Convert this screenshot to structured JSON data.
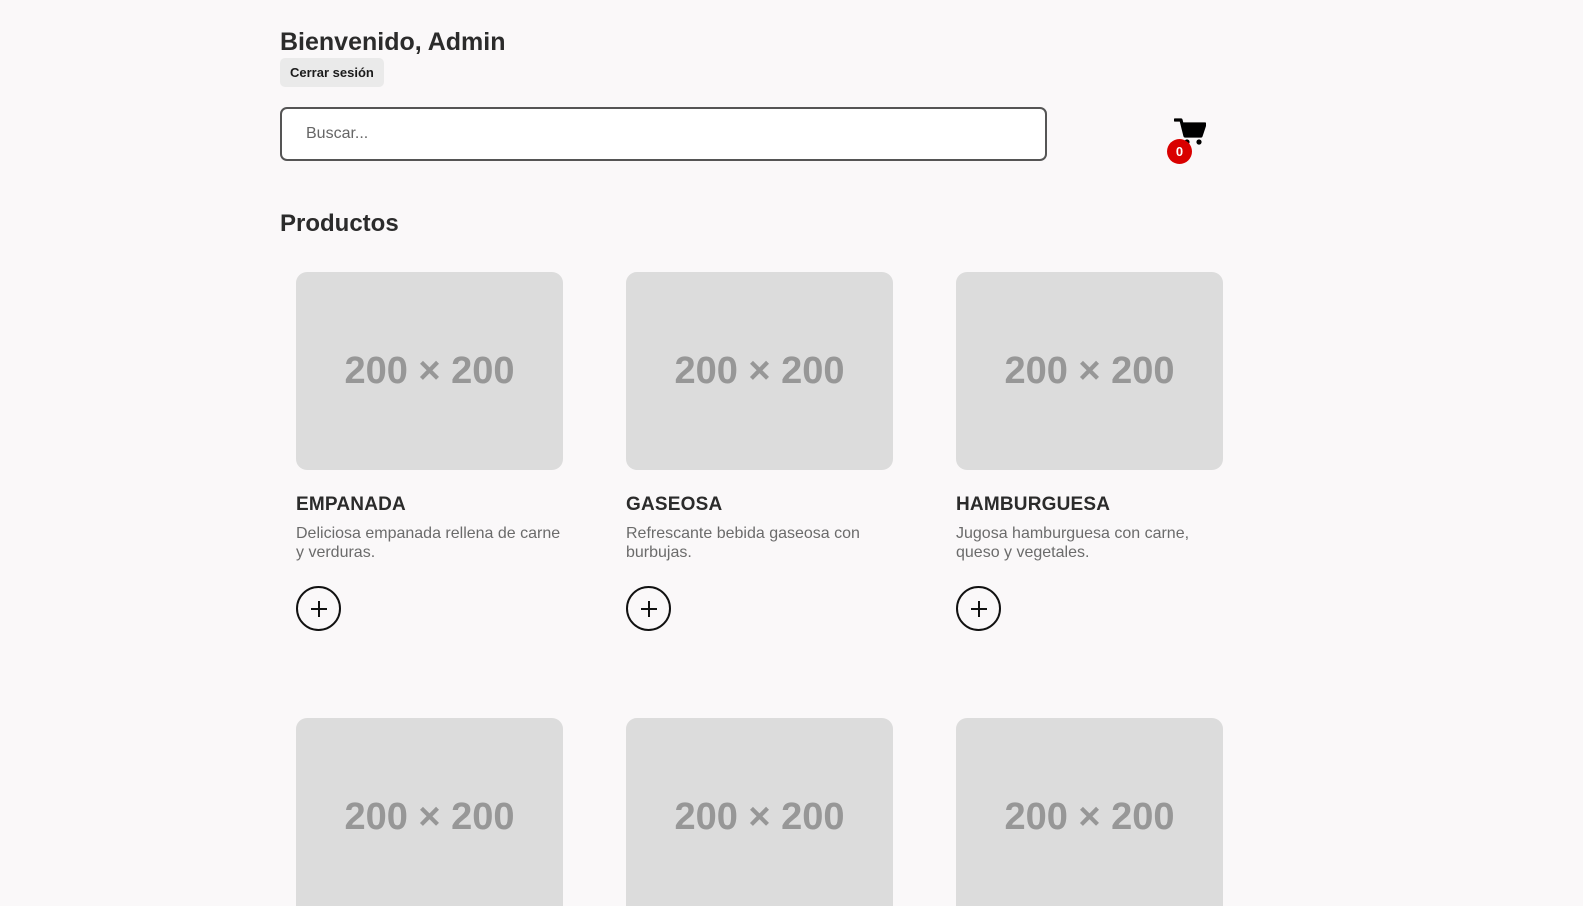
{
  "header": {
    "greeting": "Bienvenido, Admin",
    "logout_label": "Cerrar sesión"
  },
  "search": {
    "placeholder": "Buscar...",
    "value": ""
  },
  "cart": {
    "icon": "cart-icon",
    "count": "0",
    "badge_color": "#d90000"
  },
  "products_section": {
    "title": "Productos",
    "items": [
      {
        "image_label": "200 × 200",
        "name": "EMPANADA",
        "description": "Deliciosa empanada rellena de carne y verduras.",
        "add_icon": "plus-icon"
      },
      {
        "image_label": "200 × 200",
        "name": "GASEOSA",
        "description": "Refrescante bebida gaseosa con burbujas.",
        "add_icon": "plus-icon"
      },
      {
        "image_label": "200 × 200",
        "name": "HAMBURGUESA",
        "description": "Jugosa hamburguesa con carne, queso y vegetales.",
        "add_icon": "plus-icon"
      },
      {
        "image_label": "200 × 200"
      },
      {
        "image_label": "200 × 200"
      },
      {
        "image_label": "200 × 200"
      }
    ]
  }
}
